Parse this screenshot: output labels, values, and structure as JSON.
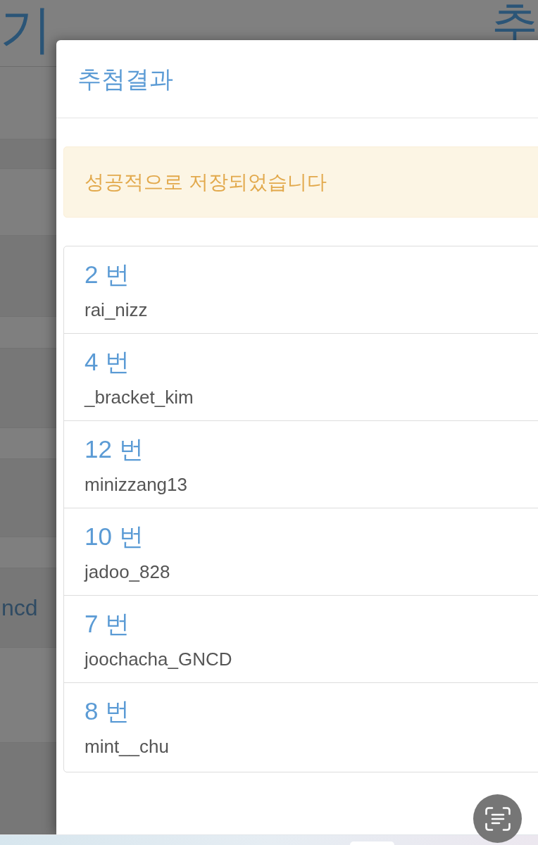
{
  "background_page": {
    "heading_left": "기",
    "heading_right": "추",
    "cell": "ncd"
  },
  "modal": {
    "title": "추첨결과",
    "alert": "성공적으로 저장되었습니다",
    "results": [
      {
        "number": "2 번",
        "username": "rai_nizz"
      },
      {
        "number": "4 번",
        "username": "_bracket_kim"
      },
      {
        "number": "12 번",
        "username": "minizzang13"
      },
      {
        "number": "10 번",
        "username": "jadoo_828"
      },
      {
        "number": "7 번",
        "username": "joochacha_GNCD"
      },
      {
        "number": "8 번",
        "username": "mint__chu"
      }
    ]
  }
}
